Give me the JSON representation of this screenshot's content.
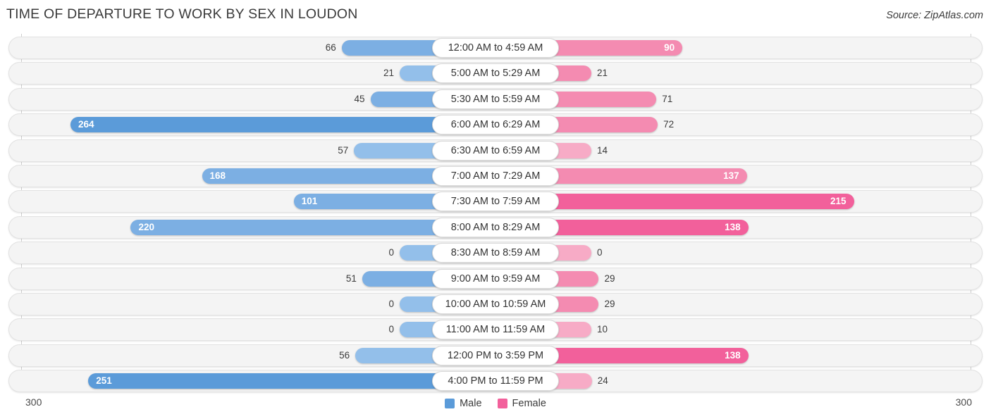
{
  "header": {
    "title": "TIME OF DEPARTURE TO WORK BY SEX IN LOUDON",
    "source": "Source: ZipAtlas.com"
  },
  "axis": {
    "left_label": "300",
    "right_label": "300",
    "max": 300
  },
  "legend": {
    "items": [
      {
        "label": "Male",
        "color": "#5B9BD9"
      },
      {
        "label": "Female",
        "color": "#F2609B"
      }
    ]
  },
  "colors": {
    "male_light": "#93BFEA",
    "male_mid": "#7CAFE3",
    "male_dark": "#5B9BD9",
    "female_light": "#F7ABC6",
    "female_mid": "#F48BB1",
    "female_dark": "#F2609B",
    "track": "#f4f4f4",
    "text": "#3b3b3b"
  },
  "chart_data": {
    "type": "bar",
    "title": "TIME OF DEPARTURE TO WORK BY SEX IN LOUDON",
    "subtitle": "",
    "orientation": "horizontal-diverging",
    "xlabel": "",
    "ylabel": "",
    "xlim": [
      300,
      300
    ],
    "grid": false,
    "legend_position": "bottom-center",
    "categories": [
      "12:00 AM to 4:59 AM",
      "5:00 AM to 5:29 AM",
      "5:30 AM to 5:59 AM",
      "6:00 AM to 6:29 AM",
      "6:30 AM to 6:59 AM",
      "7:00 AM to 7:29 AM",
      "7:30 AM to 7:59 AM",
      "8:00 AM to 8:29 AM",
      "8:30 AM to 8:59 AM",
      "9:00 AM to 9:59 AM",
      "10:00 AM to 10:59 AM",
      "11:00 AM to 11:59 AM",
      "12:00 PM to 3:59 PM",
      "4:00 PM to 11:59 PM"
    ],
    "series": [
      {
        "name": "Male",
        "values": [
          66,
          21,
          45,
          264,
          57,
          168,
          101,
          220,
          0,
          51,
          0,
          0,
          56,
          251
        ]
      },
      {
        "name": "Female",
        "values": [
          90,
          21,
          71,
          72,
          14,
          137,
          215,
          138,
          0,
          29,
          29,
          10,
          138,
          24
        ]
      }
    ]
  },
  "rows": [
    {
      "category": "12:00 AM to 4:59 AM",
      "male": 66,
      "female": 90,
      "male_text": "66",
      "female_text": "90",
      "male_shade": "mid",
      "female_shade": "mid"
    },
    {
      "category": "5:00 AM to 5:29 AM",
      "male": 21,
      "female": 21,
      "male_text": "21",
      "female_text": "21",
      "male_shade": "light",
      "female_shade": "mid"
    },
    {
      "category": "5:30 AM to 5:59 AM",
      "male": 45,
      "female": 71,
      "male_text": "45",
      "female_text": "71",
      "male_shade": "mid",
      "female_shade": "mid"
    },
    {
      "category": "6:00 AM to 6:29 AM",
      "male": 264,
      "female": 72,
      "male_text": "264",
      "female_text": "72",
      "male_shade": "dark",
      "female_shade": "mid"
    },
    {
      "category": "6:30 AM to 6:59 AM",
      "male": 57,
      "female": 14,
      "male_text": "57",
      "female_text": "14",
      "male_shade": "light",
      "female_shade": "light"
    },
    {
      "category": "7:00 AM to 7:29 AM",
      "male": 168,
      "female": 137,
      "male_text": "168",
      "female_text": "137",
      "male_shade": "mid",
      "female_shade": "mid"
    },
    {
      "category": "7:30 AM to 7:59 AM",
      "male": 101,
      "female": 215,
      "male_text": "101",
      "female_text": "215",
      "male_shade": "mid",
      "female_shade": "dark"
    },
    {
      "category": "8:00 AM to 8:29 AM",
      "male": 220,
      "female": 138,
      "male_text": "220",
      "female_text": "138",
      "male_shade": "mid",
      "female_shade": "dark"
    },
    {
      "category": "8:30 AM to 8:59 AM",
      "male": 0,
      "female": 0,
      "male_text": "0",
      "female_text": "0",
      "male_shade": "light",
      "female_shade": "light"
    },
    {
      "category": "9:00 AM to 9:59 AM",
      "male": 51,
      "female": 29,
      "male_text": "51",
      "female_text": "29",
      "male_shade": "mid",
      "female_shade": "mid"
    },
    {
      "category": "10:00 AM to 10:59 AM",
      "male": 0,
      "female": 29,
      "male_text": "0",
      "female_text": "29",
      "male_shade": "light",
      "female_shade": "mid"
    },
    {
      "category": "11:00 AM to 11:59 AM",
      "male": 0,
      "female": 10,
      "male_text": "0",
      "female_text": "10",
      "male_shade": "light",
      "female_shade": "light"
    },
    {
      "category": "12:00 PM to 3:59 PM",
      "male": 56,
      "female": 138,
      "male_text": "56",
      "female_text": "138",
      "male_shade": "light",
      "female_shade": "dark"
    },
    {
      "category": "4:00 PM to 11:59 PM",
      "male": 251,
      "female": 24,
      "male_text": "251",
      "female_text": "24",
      "male_shade": "dark",
      "female_shade": "light"
    }
  ]
}
